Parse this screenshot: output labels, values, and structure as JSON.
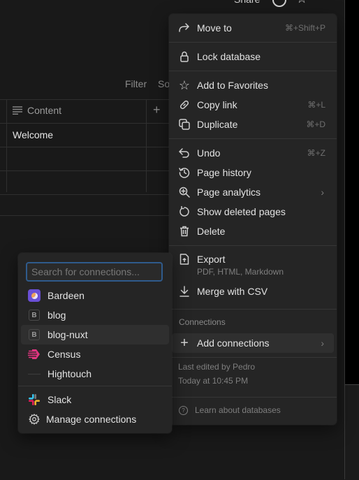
{
  "topbar": {
    "share_label": "Share",
    "icons": [
      "clock-icon",
      "star-icon",
      "more-icon"
    ]
  },
  "toolbar": {
    "filter_label": "Filter",
    "sort_label": "So"
  },
  "table": {
    "column_header": "Content",
    "add_column_label": "+",
    "rows": [
      "Welcome",
      "",
      ""
    ]
  },
  "menu": {
    "items": [
      {
        "label": "Move to",
        "shortcut": "⌘+Shift+P",
        "icon": "arrow-turn-right-icon"
      },
      {
        "label": "Lock database",
        "icon": "lock-icon"
      },
      {
        "label": "Add to Favorites",
        "icon": "star-icon"
      },
      {
        "label": "Copy link",
        "shortcut": "⌘+L",
        "icon": "link-icon"
      },
      {
        "label": "Duplicate",
        "shortcut": "⌘+D",
        "icon": "duplicate-icon"
      },
      {
        "label": "Undo",
        "shortcut": "⌘+Z",
        "icon": "undo-icon"
      },
      {
        "label": "Page history",
        "icon": "history-icon"
      },
      {
        "label": "Page analytics",
        "icon": "zoom-in-icon",
        "has_submenu": true
      },
      {
        "label": "Show deleted pages",
        "icon": "restore-icon"
      },
      {
        "label": "Delete",
        "icon": "trash-icon"
      },
      {
        "label": "Export",
        "sublabel": "PDF, HTML, Markdown",
        "icon": "export-icon"
      },
      {
        "label": "Merge with CSV",
        "icon": "download-icon"
      }
    ],
    "connections_section_label": "Connections",
    "add_connections_label": "Add connections",
    "last_edited_by": "Last edited by Pedro",
    "last_edited_time": "Today at 10:45 PM",
    "learn_label": "Learn about databases"
  },
  "connections_popup": {
    "search_placeholder": "Search for connections...",
    "search_value": "",
    "items": [
      {
        "label": "Bardeen",
        "icon": "bardeen-icon"
      },
      {
        "label": "blog",
        "icon": "b-badge-icon",
        "badge": "B"
      },
      {
        "label": "blog-nuxt",
        "icon": "b-badge-icon",
        "badge": "B",
        "highlighted": true
      },
      {
        "label": "Census",
        "icon": "census-icon"
      },
      {
        "label": "Hightouch",
        "icon": "hightouch-icon"
      }
    ],
    "footer_items": [
      {
        "label": "Slack",
        "icon": "slack-icon"
      },
      {
        "label": "Manage connections",
        "icon": "gear-icon"
      }
    ]
  },
  "colors": {
    "background": "#191919",
    "menu_bg": "#252525",
    "highlight_bg": "#2f2f2f",
    "search_focus_border": "#2f5b8c",
    "bardeen": "#6a4fd6",
    "census": "#e0357f"
  }
}
